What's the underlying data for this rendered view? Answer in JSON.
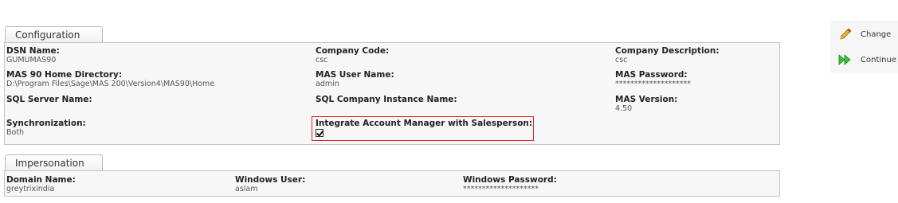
{
  "configuration": {
    "tab_label": "Configuration",
    "fields": [
      {
        "label": "DSN Name:",
        "value": "GUMUMAS90"
      },
      {
        "label": "Company Code:",
        "value": "csc"
      },
      {
        "label": "Company Description:",
        "value": "csc"
      },
      {
        "label": "MAS 90 Home Directory:",
        "value": "D:\\Program Files\\Sage\\MAS 200\\Version4\\MAS90\\Home"
      },
      {
        "label": "MAS User Name:",
        "value": "admin"
      },
      {
        "label": "MAS Password:",
        "value": "********************"
      },
      {
        "label": "SQL Server Name:",
        "value": ""
      },
      {
        "label": "SQL Company Instance Name:",
        "value": ""
      },
      {
        "label": "MAS Version:",
        "value": "4.50"
      },
      {
        "label": "Synchronization:",
        "value": "Both"
      },
      {
        "label": "Integrate Account Manager with Salesperson:",
        "value": "",
        "checked": true
      }
    ]
  },
  "impersonation": {
    "tab_label": "Impersonation",
    "fields": [
      {
        "label": "Domain Name:",
        "value": "greytrixindia"
      },
      {
        "label": "Windows User:",
        "value": "aslam"
      },
      {
        "label": "Windows Password:",
        "value": "********************"
      }
    ]
  },
  "actions": {
    "change_label": "Change",
    "continue_label": "Continue"
  },
  "colors": {
    "highlight": "#e0232b",
    "continue_icon": "#2bb02b",
    "change_icon": "#e0a020"
  }
}
